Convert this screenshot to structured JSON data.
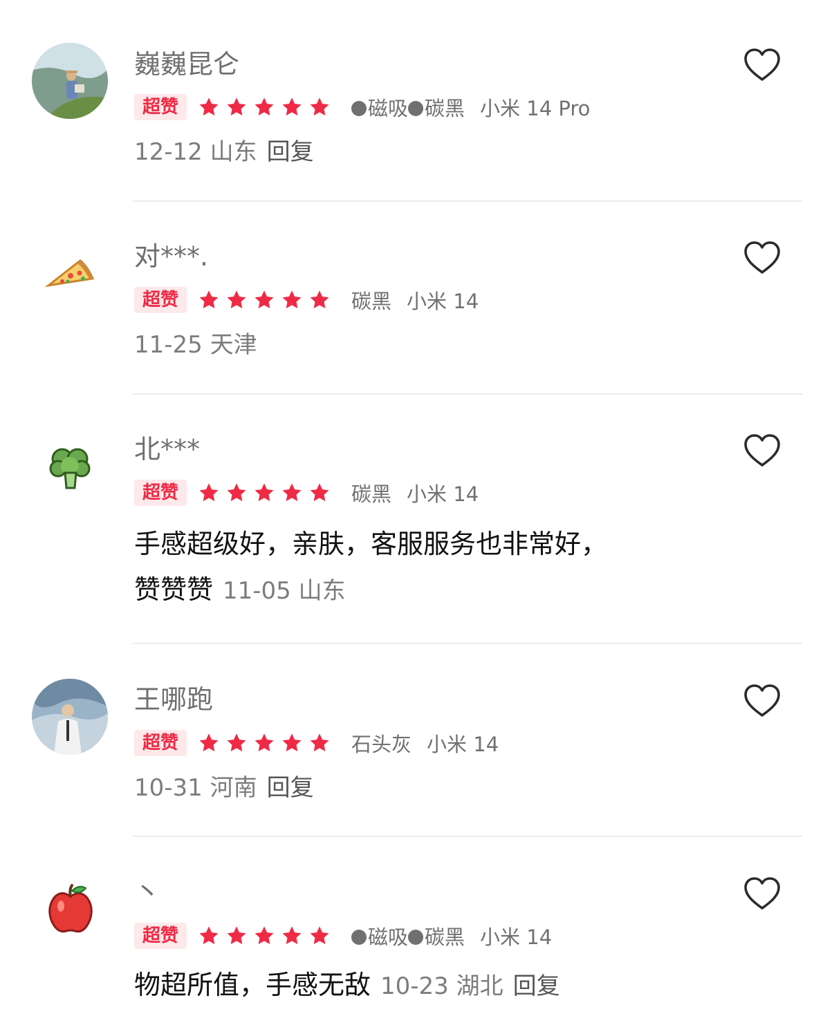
{
  "reviews": [
    {
      "name": "巍巍昆仑",
      "badge": "超赞",
      "rating": 5,
      "sku": [
        "磁吸",
        "碳黑"
      ],
      "model": "小米 14 Pro",
      "date_location": "12-12 山东",
      "reply": "回复",
      "avatar": "photo-avatar"
    },
    {
      "name": "对***.",
      "badge": "超赞",
      "rating": 5,
      "sku": [
        "碳黑"
      ],
      "model": "小米 14",
      "date_location": "11-25 天津",
      "avatar": "pizza-icon"
    },
    {
      "name": "北***",
      "badge": "超赞",
      "rating": 5,
      "sku": [
        "碳黑"
      ],
      "model": "小米 14",
      "content_line1": "手感超级好，亲肤，客服服务也非常好，",
      "content_line2": "赞赞赞",
      "date_location": "11-05 山东",
      "avatar": "broccoli-icon"
    },
    {
      "name": "王哪跑",
      "badge": "超赞",
      "rating": 5,
      "sku": [
        "石头灰"
      ],
      "model": "小米 14",
      "date_location": "10-31 河南",
      "reply": "回复",
      "avatar": "photo-avatar"
    },
    {
      "name": "丶",
      "badge": "超赞",
      "rating": 5,
      "sku": [
        "磁吸",
        "碳黑"
      ],
      "model": "小米 14",
      "content": "物超所值，手感无敌",
      "date_location": "10-23 湖北",
      "reply": "回复",
      "avatar": "apple-icon"
    }
  ],
  "colors": {
    "star": "#ef2a45",
    "badge_bg": "#fde8ea",
    "badge_text": "#ef2a45"
  }
}
